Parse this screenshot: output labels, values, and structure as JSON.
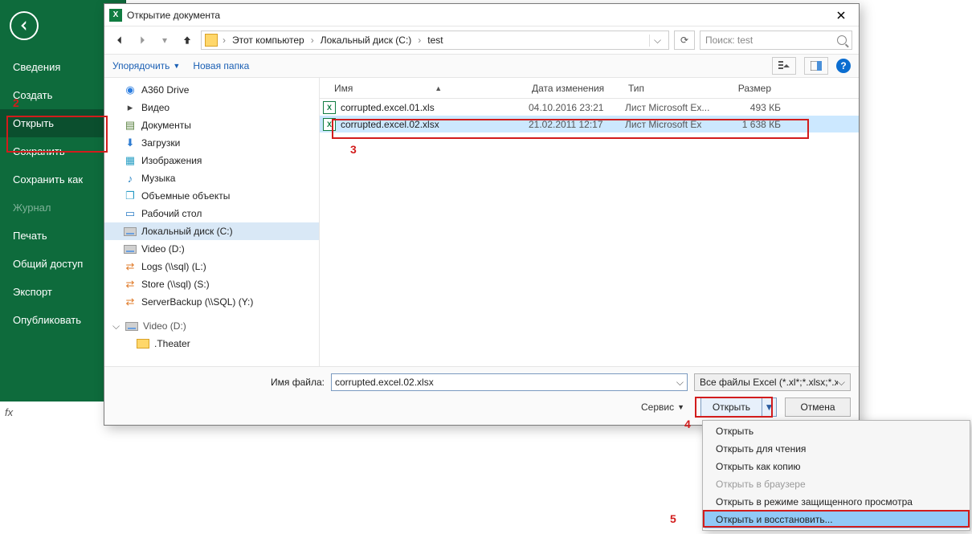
{
  "backstage": {
    "items": [
      {
        "label": "Сведения"
      },
      {
        "label": "Создать"
      },
      {
        "label": "Открыть",
        "selected": true
      },
      {
        "label": "Сохранить"
      },
      {
        "label": "Сохранить как"
      },
      {
        "label": "Журнал",
        "disabled": true
      },
      {
        "label": "Печать"
      },
      {
        "label": "Общий доступ"
      },
      {
        "label": "Экспорт"
      },
      {
        "label": "Опубликовать"
      }
    ]
  },
  "formula_bar_fx": "fx",
  "dialog": {
    "title": "Открытие документа",
    "breadcrumb": [
      "Этот компьютер",
      "Локальный диск (C:)",
      "test"
    ],
    "search_placeholder": "Поиск: test",
    "toolbar": {
      "organize": "Упорядочить",
      "new_folder": "Новая папка"
    },
    "tree": [
      {
        "icon": "a360",
        "label": "A360 Drive"
      },
      {
        "icon": "video",
        "label": "Видео"
      },
      {
        "icon": "doc",
        "label": "Документы"
      },
      {
        "icon": "dl",
        "label": "Загрузки"
      },
      {
        "icon": "img",
        "label": "Изображения"
      },
      {
        "icon": "music",
        "label": "Музыка"
      },
      {
        "icon": "obj",
        "label": "Объемные объекты"
      },
      {
        "icon": "desk",
        "label": "Рабочий стол"
      },
      {
        "icon": "drive",
        "label": "Локальный диск (C:)",
        "selected": true
      },
      {
        "icon": "drive",
        "label": "Video (D:)"
      },
      {
        "icon": "net",
        "label": "Logs (\\\\sql) (L:)"
      },
      {
        "icon": "net",
        "label": "Store (\\\\sql) (S:)"
      },
      {
        "icon": "net",
        "label": "ServerBackup (\\\\SQL) (Y:)"
      }
    ],
    "tree_group": {
      "label": "Video (D:)"
    },
    "tree_group_sub": {
      "label": ".Theater"
    },
    "columns": {
      "name": "Имя",
      "date": "Дата изменения",
      "type": "Тип",
      "size": "Размер"
    },
    "files": [
      {
        "name": "corrupted.excel.01.xls",
        "date": "04.10.2016 23:21",
        "type": "Лист Microsoft Ex...",
        "size": "493 КБ"
      },
      {
        "name": "corrupted.excel.02.xlsx",
        "date": "21.02.2011 12:17",
        "type": "Лист Microsoft Ex",
        "size": "1 638 КБ",
        "selected": true
      }
    ],
    "filename_label": "Имя файла:",
    "filename_value": "corrupted.excel.02.xlsx",
    "filetype": "Все файлы Excel (*.xl*;*.xlsx;*.xl",
    "tools": "Сервис",
    "open_btn": "Открыть",
    "cancel_btn": "Отмена"
  },
  "menu": [
    {
      "label": "Открыть"
    },
    {
      "label": "Открыть для чтения"
    },
    {
      "label": "Открыть как копию"
    },
    {
      "label": "Открыть в браузере",
      "disabled": true
    },
    {
      "label": "Открыть в режиме защищенного просмотра"
    },
    {
      "label": "Открыть и восстановить...",
      "highlight": true
    }
  ],
  "annotations": {
    "n2": "2",
    "n3": "3",
    "n4": "4",
    "n5": "5"
  }
}
